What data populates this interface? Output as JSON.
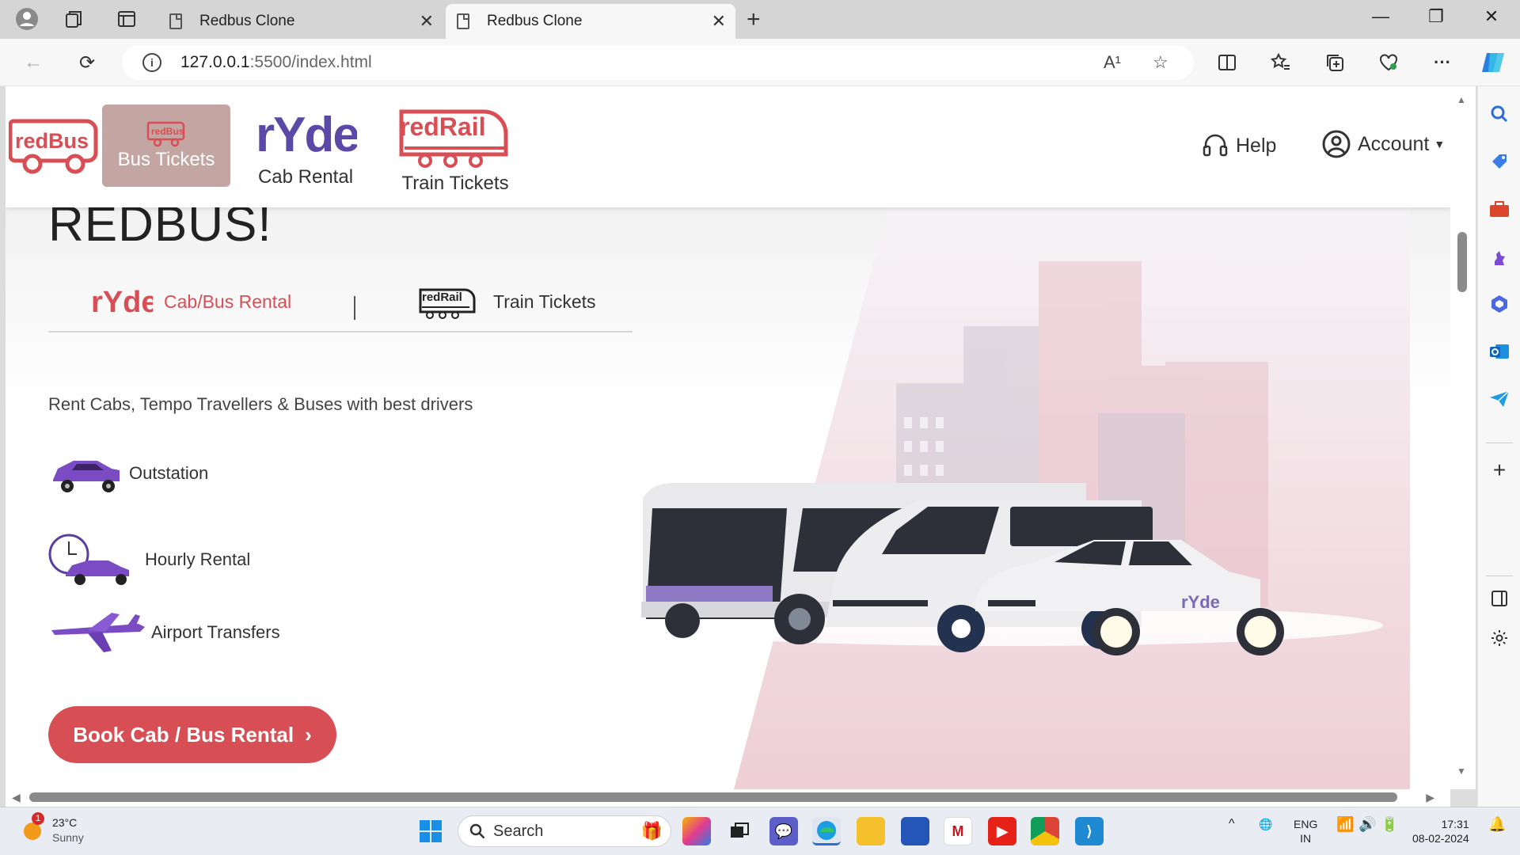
{
  "browser": {
    "tabs": [
      {
        "title": "Redbus Clone",
        "active": false
      },
      {
        "title": "Redbus Clone",
        "active": true
      }
    ],
    "url_host": "127.0.0.1",
    "url_rest": ":5500/index.html",
    "read_aloud_label": "A¹"
  },
  "header": {
    "logo_text": "redBus",
    "bus_tickets": "Bus Tickets",
    "bus_tab_logo": "redBus",
    "cab_logo": "rYde",
    "cab_rental": "Cab Rental",
    "rail_logo": "redRail",
    "train_tickets": "Train Tickets",
    "help": "Help",
    "account": "Account"
  },
  "hero": {
    "title": "REDBUS!",
    "mode_ryde_logo": "rYde",
    "mode_ryde_label": "Cab/Bus Rental",
    "mode_rail_logo": "redRail",
    "mode_rail_label": "Train Tickets",
    "tagline": "Rent Cabs, Tempo Travellers & Buses with best drivers",
    "features": [
      "Outstation",
      "Hourly Rental",
      "Airport Transfers"
    ],
    "book_button": "Book Cab / Bus Rental",
    "car_brand": "rYde"
  },
  "taskbar": {
    "weather_badge": "1",
    "temperature": "23°C",
    "condition": "Sunny",
    "search": "Search",
    "lang_1": "ENG",
    "lang_2": "IN",
    "time": "17:31",
    "date": "08-02-2024"
  },
  "colors": {
    "brand_red": "#d84e55",
    "ryde_purple": "#6a4fb0",
    "bus_tab_bg": "#c3a5a2"
  }
}
